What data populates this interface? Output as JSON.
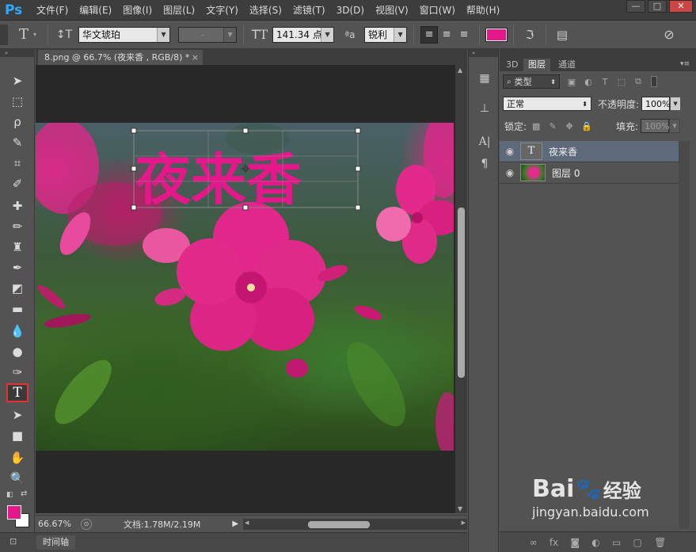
{
  "app": {
    "logo": "Ps",
    "menu": [
      "文件(F)",
      "编辑(E)",
      "图像(I)",
      "图层(L)",
      "文字(Y)",
      "选择(S)",
      "滤镜(T)",
      "3D(D)",
      "视图(V)",
      "窗口(W)",
      "帮助(H)"
    ],
    "window_buttons": {
      "minimize": "—",
      "restore": "□",
      "close": "✕"
    }
  },
  "options": {
    "font_family": "华文琥珀",
    "font_style": "-",
    "font_size": "141.34 点",
    "antialias_icon": "ªa",
    "antialias": "锐利",
    "text_color": "#e4178b"
  },
  "document": {
    "tab_title": "8.png @ 66.7% (夜来香 , RGB/8) *",
    "tab_close": "×",
    "text_layer_content": "夜来香",
    "text_color": "#e4178b"
  },
  "status": {
    "zoom": "66.67%",
    "doc_info": "文档:1.78M/2.19M"
  },
  "timeline": {
    "label": "时间轴"
  },
  "colors": {
    "foreground": "#e4178b",
    "background": "#ffffff"
  },
  "layers_panel": {
    "tabs": [
      "3D",
      "图层",
      "通道"
    ],
    "filter_label": "类型",
    "blend_mode": "正常",
    "opacity_label": "不透明度:",
    "opacity": "100%",
    "lock_label": "锁定:",
    "fill_label": "填充:",
    "fill": "100%",
    "layers": [
      {
        "name": "夜来香",
        "type": "text",
        "selected": true,
        "thumb": "T"
      },
      {
        "name": "图层 0",
        "type": "image",
        "selected": false
      }
    ]
  },
  "watermark": {
    "brand": "Bai",
    "brand_suffix": "经验",
    "url": "jingyan.baidu.com"
  }
}
